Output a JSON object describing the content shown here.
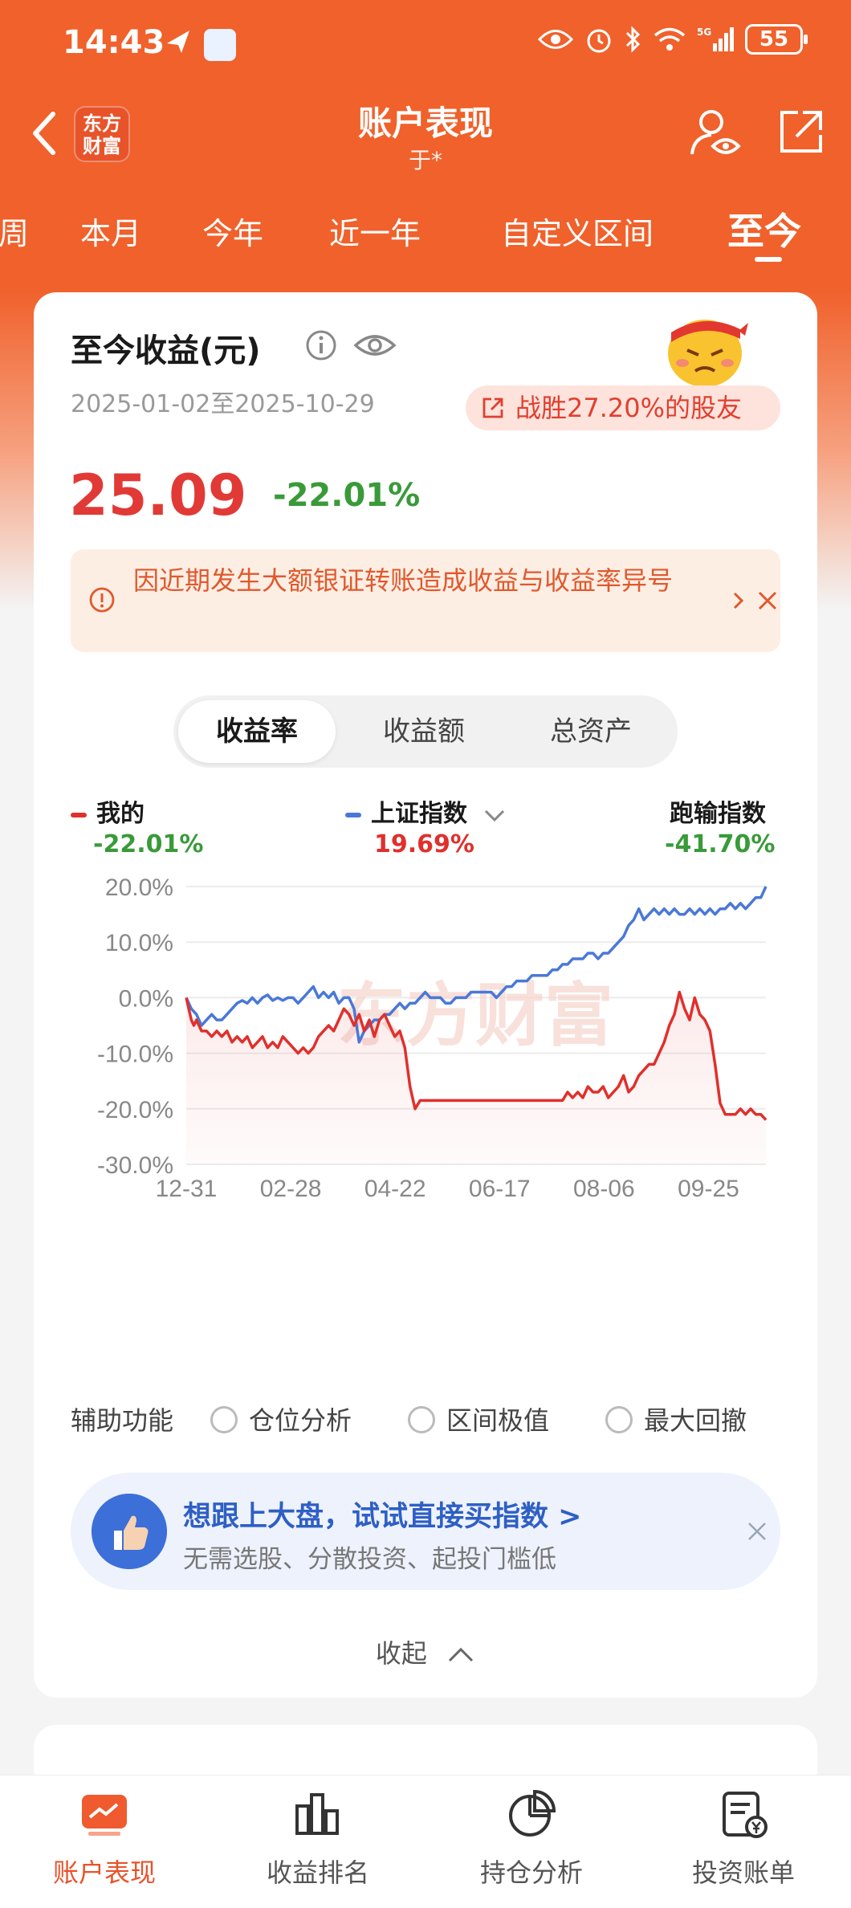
{
  "status_bar": {
    "time": "14:43",
    "battery": "55",
    "network": "5G"
  },
  "header": {
    "title": "账户表现",
    "subtitle": "于*",
    "logo_text_line1": "东方",
    "logo_text_line2": "财富"
  },
  "tabs": [
    {
      "label": "周"
    },
    {
      "label": "本月"
    },
    {
      "label": "今年"
    },
    {
      "label": "近一年"
    },
    {
      "label": "自定义区间"
    },
    {
      "label": "至今",
      "active": true
    }
  ],
  "summary": {
    "title": "至今收益(元)",
    "date_range": "2025-01-02至2025-10-29",
    "beat_text": "战胜27.20%的股友",
    "profit": "25.09",
    "rate": "-22.01%"
  },
  "notice": {
    "text": "因近期发生大额银证转账造成收益与收益率异号"
  },
  "segment": {
    "items": [
      "收益率",
      "收益额",
      "总资产"
    ],
    "active": 0
  },
  "legend": [
    {
      "name": "我的",
      "value": "-22.01%",
      "color": "#e0302c",
      "value_color": "#3a9a3a"
    },
    {
      "name": "上证指数",
      "value": "19.69%",
      "color": "#4a78d8",
      "value_color": "#e0302c"
    },
    {
      "name": "跑输指数",
      "value": "-41.70%",
      "color": "",
      "value_color": "#3a9a3a"
    }
  ],
  "chart_data": {
    "type": "line",
    "y_ticks": [
      "20.0%",
      "10.0%",
      "0.0%",
      "-10.0%",
      "-20.0%",
      "-30.0%"
    ],
    "x_ticks": [
      "12-31",
      "02-28",
      "04-22",
      "06-17",
      "08-06",
      "09-25"
    ],
    "ylim": [
      -30,
      20
    ],
    "watermark": "东方财富",
    "series": [
      {
        "name": "我的",
        "color": "#e0302c",
        "points": [
          [
            0,
            0
          ],
          [
            2,
            -4
          ],
          [
            3,
            -5
          ],
          [
            4,
            -4
          ],
          [
            6,
            -6
          ],
          [
            8,
            -6
          ],
          [
            10,
            -7
          ],
          [
            12,
            -6
          ],
          [
            14,
            -7
          ],
          [
            16,
            -6
          ],
          [
            18,
            -8
          ],
          [
            20,
            -7
          ],
          [
            22,
            -8
          ],
          [
            24,
            -7
          ],
          [
            26,
            -9
          ],
          [
            28,
            -8
          ],
          [
            30,
            -7
          ],
          [
            32,
            -9
          ],
          [
            34,
            -8
          ],
          [
            36,
            -9
          ],
          [
            38,
            -7
          ],
          [
            40,
            -8
          ],
          [
            42,
            -9
          ],
          [
            44,
            -10
          ],
          [
            46,
            -9
          ],
          [
            48,
            -10
          ],
          [
            50,
            -9
          ],
          [
            52,
            -7
          ],
          [
            54,
            -6
          ],
          [
            56,
            -5
          ],
          [
            58,
            -6
          ],
          [
            60,
            -4
          ],
          [
            62,
            -2
          ],
          [
            64,
            -3
          ],
          [
            66,
            -5
          ],
          [
            68,
            -3
          ],
          [
            70,
            -6
          ],
          [
            72,
            -4
          ],
          [
            74,
            -7
          ],
          [
            76,
            -4
          ],
          [
            78,
            -3
          ],
          [
            80,
            -5
          ],
          [
            82,
            -7
          ],
          [
            84,
            -6
          ],
          [
            86,
            -9
          ],
          [
            88,
            -16
          ],
          [
            90,
            -20
          ],
          [
            92,
            -18.5
          ],
          [
            100,
            -18.5
          ],
          [
            110,
            -18.5
          ],
          [
            120,
            -18.5
          ],
          [
            130,
            -18.5
          ],
          [
            140,
            -18.5
          ],
          [
            148,
            -18.5
          ],
          [
            150,
            -17
          ],
          [
            152,
            -18
          ],
          [
            154,
            -17
          ],
          [
            156,
            -18
          ],
          [
            158,
            -16
          ],
          [
            160,
            -17
          ],
          [
            162,
            -17
          ],
          [
            164,
            -16
          ],
          [
            166,
            -18
          ],
          [
            168,
            -17
          ],
          [
            170,
            -16
          ],
          [
            172,
            -14
          ],
          [
            174,
            -17
          ],
          [
            176,
            -16
          ],
          [
            178,
            -14
          ],
          [
            180,
            -13
          ],
          [
            182,
            -12
          ],
          [
            184,
            -12
          ],
          [
            186,
            -10
          ],
          [
            188,
            -8
          ],
          [
            190,
            -5
          ],
          [
            192,
            -3
          ],
          [
            194,
            1
          ],
          [
            196,
            -2
          ],
          [
            198,
            -4
          ],
          [
            200,
            0
          ],
          [
            202,
            -3
          ],
          [
            204,
            -4
          ],
          [
            206,
            -6
          ],
          [
            208,
            -12
          ],
          [
            210,
            -19
          ],
          [
            212,
            -21
          ],
          [
            214,
            -21
          ],
          [
            216,
            -21
          ],
          [
            218,
            -20
          ],
          [
            220,
            -21
          ],
          [
            222,
            -20
          ],
          [
            224,
            -21
          ],
          [
            226,
            -21
          ],
          [
            228,
            -22
          ]
        ]
      },
      {
        "name": "上证指数",
        "color": "#4a78d8",
        "points": [
          [
            0,
            0
          ],
          [
            2,
            -2
          ],
          [
            4,
            -3
          ],
          [
            6,
            -5
          ],
          [
            8,
            -4
          ],
          [
            10,
            -3
          ],
          [
            12,
            -4
          ],
          [
            14,
            -4
          ],
          [
            16,
            -3
          ],
          [
            18,
            -2
          ],
          [
            20,
            -1
          ],
          [
            22,
            -0.5
          ],
          [
            24,
            -1
          ],
          [
            26,
            0
          ],
          [
            28,
            -1
          ],
          [
            30,
            0
          ],
          [
            32,
            0.5
          ],
          [
            34,
            -0.5
          ],
          [
            36,
            0
          ],
          [
            38,
            -0.5
          ],
          [
            40,
            0
          ],
          [
            42,
            0
          ],
          [
            44,
            -1
          ],
          [
            46,
            0
          ],
          [
            48,
            1
          ],
          [
            50,
            2
          ],
          [
            52,
            0
          ],
          [
            54,
            1
          ],
          [
            56,
            0
          ],
          [
            58,
            1
          ],
          [
            60,
            -1
          ],
          [
            62,
            0
          ],
          [
            64,
            0
          ],
          [
            66,
            -2
          ],
          [
            68,
            -8
          ],
          [
            70,
            -6
          ],
          [
            72,
            -5
          ],
          [
            74,
            -4
          ],
          [
            76,
            -4
          ],
          [
            78,
            -3
          ],
          [
            80,
            -3
          ],
          [
            82,
            -2
          ],
          [
            84,
            -1
          ],
          [
            86,
            -2
          ],
          [
            88,
            -1
          ],
          [
            90,
            -1
          ],
          [
            92,
            0
          ],
          [
            94,
            1
          ],
          [
            96,
            0
          ],
          [
            98,
            0
          ],
          [
            100,
            0
          ],
          [
            102,
            -1
          ],
          [
            104,
            -1
          ],
          [
            106,
            0
          ],
          [
            108,
            0
          ],
          [
            110,
            0
          ],
          [
            112,
            1
          ],
          [
            114,
            1
          ],
          [
            116,
            1
          ],
          [
            118,
            1
          ],
          [
            120,
            1
          ],
          [
            122,
            0
          ],
          [
            124,
            1
          ],
          [
            126,
            2
          ],
          [
            128,
            2
          ],
          [
            130,
            3
          ],
          [
            132,
            3
          ],
          [
            134,
            3
          ],
          [
            136,
            4
          ],
          [
            138,
            4
          ],
          [
            140,
            4
          ],
          [
            142,
            4
          ],
          [
            144,
            5
          ],
          [
            146,
            5
          ],
          [
            148,
            6
          ],
          [
            150,
            6
          ],
          [
            152,
            7
          ],
          [
            154,
            7
          ],
          [
            156,
            7
          ],
          [
            158,
            8
          ],
          [
            160,
            8
          ],
          [
            162,
            7
          ],
          [
            164,
            8
          ],
          [
            166,
            8
          ],
          [
            168,
            9
          ],
          [
            170,
            10
          ],
          [
            172,
            11
          ],
          [
            174,
            13
          ],
          [
            176,
            14
          ],
          [
            178,
            16
          ],
          [
            180,
            14
          ],
          [
            182,
            15
          ],
          [
            184,
            16
          ],
          [
            186,
            15
          ],
          [
            188,
            16
          ],
          [
            190,
            15
          ],
          [
            192,
            16
          ],
          [
            194,
            15
          ],
          [
            196,
            15
          ],
          [
            198,
            16
          ],
          [
            200,
            15
          ],
          [
            202,
            16
          ],
          [
            204,
            15
          ],
          [
            206,
            16
          ],
          [
            208,
            15
          ],
          [
            210,
            16
          ],
          [
            212,
            16
          ],
          [
            214,
            17
          ],
          [
            216,
            16
          ],
          [
            218,
            17
          ],
          [
            220,
            16
          ],
          [
            222,
            17
          ],
          [
            224,
            18
          ],
          [
            226,
            18
          ],
          [
            228,
            20
          ]
        ]
      }
    ],
    "x_max": 228
  },
  "assist": {
    "label": "辅助功能",
    "options": [
      "仓位分析",
      "区间极值",
      "最大回撤"
    ]
  },
  "promo": {
    "title": "想跟上大盘，试试直接买指数 >",
    "subtitle": "无需选股、分散投资、起投门槛低"
  },
  "collapse": {
    "label": "收起"
  },
  "bottom_nav": [
    {
      "label": "账户表现",
      "active": true
    },
    {
      "label": "收益排名"
    },
    {
      "label": "持仓分析"
    },
    {
      "label": "投资账单"
    }
  ]
}
